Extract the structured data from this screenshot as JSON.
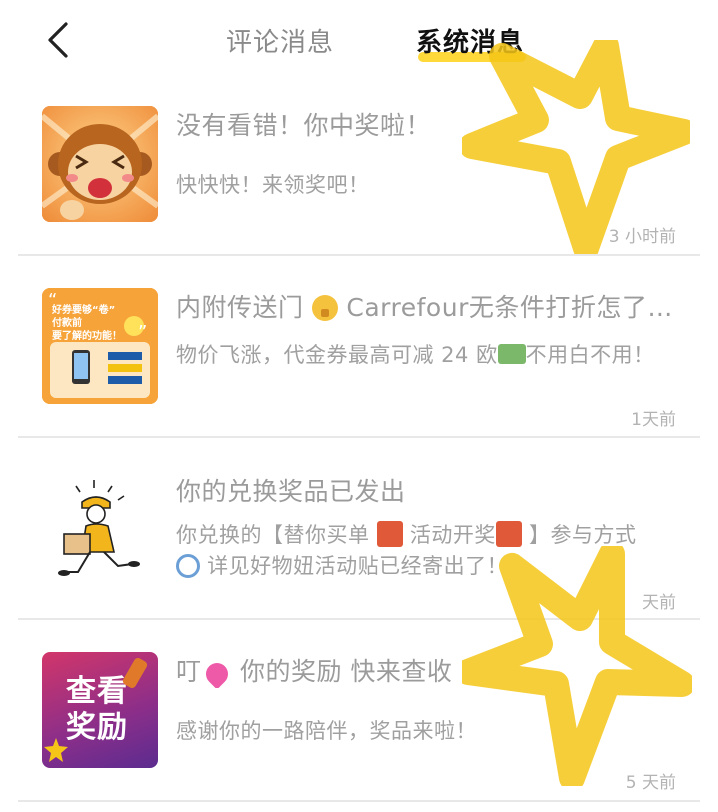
{
  "header": {
    "tabs": [
      {
        "label": "评论消息",
        "active": false
      },
      {
        "label": "系统消息",
        "active": true
      }
    ]
  },
  "messages": [
    {
      "title": "没有看错！你中奖啦！",
      "body": "快快快！来领奖吧！",
      "time": "3 小时前",
      "thumb_icon": "monkey-sticker"
    },
    {
      "title_pre": "内附传送门 ",
      "title_post": " Carrefour无条件打折怎了…",
      "body_pre": "物价飞涨，代金券最高可减 24 欧",
      "body_post": "不用白不用！",
      "time": "1天前",
      "thumb_icon": "coupon-poster",
      "thumb_text": {
        "line1": "好券要够“卷”",
        "line2": "付款前",
        "line3": "要了解的功能！"
      }
    },
    {
      "title": "你的兑换奖品已发出",
      "body_a": "你兑换的【替你买单 ",
      "body_b": " 活动开奖",
      "body_c": " 】参与方式 ",
      "body_d": " 详见好物妞活动贴已经寄出了！",
      "time": "天前",
      "thumb_icon": "courier-illustration"
    },
    {
      "title_pre": "叮",
      "title_post": " 你的奖励 快来查收",
      "body": "感谢你的一路陪伴，奖品来啦！",
      "time": "5 天前",
      "thumb_icon": "reward-card",
      "thumb_text": {
        "line1": "查看",
        "line2": "奖励"
      }
    }
  ],
  "colors": {
    "accent_yellow": "#ffd83a",
    "star_yellow": "#f5c518",
    "reward_gradient_top": "#c33a6e",
    "reward_gradient_bottom": "#6a2d8c"
  }
}
